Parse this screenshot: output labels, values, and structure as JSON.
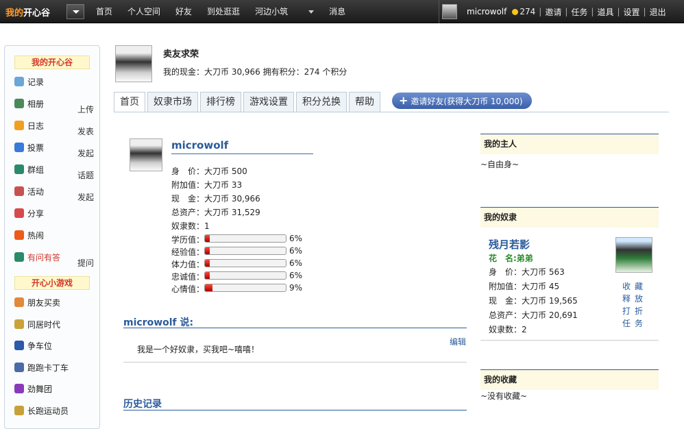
{
  "topbar": {
    "logo_a": "我的",
    "logo_b": "开心谷",
    "nav": [
      "首页",
      "个人空间",
      "好友",
      "到处逛逛",
      "河边小筑",
      "消息"
    ],
    "username": "microwolf",
    "coins": "274",
    "links": [
      "邀请",
      "任务",
      "道具",
      "设置",
      "退出"
    ]
  },
  "sidebar": {
    "head1": "我的开心谷",
    "items": [
      {
        "label": "记录",
        "action": "",
        "icon": "chat-icon",
        "color": "#6aa6d8"
      },
      {
        "label": "相册",
        "action": "上传",
        "icon": "photo-icon",
        "color": "#4a8a5a"
      },
      {
        "label": "日志",
        "action": "发表",
        "icon": "diary-icon",
        "color": "#f0a020"
      },
      {
        "label": "投票",
        "action": "发起",
        "icon": "chart-icon",
        "color": "#3a7ad8"
      },
      {
        "label": "群组",
        "action": "话题",
        "icon": "group-icon",
        "color": "#2a8a6a"
      },
      {
        "label": "活动",
        "action": "发起",
        "icon": "calendar-icon",
        "color": "#c85050"
      },
      {
        "label": "分享",
        "action": "",
        "icon": "heart-icon",
        "color": "#d84a4a"
      },
      {
        "label": "热闹",
        "action": "",
        "icon": "fire-icon",
        "color": "#ee5a1a"
      },
      {
        "label": "有问有答",
        "action": "提问",
        "icon": "qa-icon",
        "color": "#2a8a6a",
        "red": true
      }
    ],
    "head2": "开心小游戏",
    "games": [
      {
        "label": "朋友买卖",
        "icon": "people-icon",
        "color": "#e08a3a"
      },
      {
        "label": "同居时代",
        "icon": "house-icon",
        "color": "#caa23a"
      },
      {
        "label": "争车位",
        "icon": "parking-icon",
        "color": "#2a5aa8"
      },
      {
        "label": "跑跑卡丁车",
        "icon": "kart-icon",
        "color": "#4a6aa8"
      },
      {
        "label": "劲舞团",
        "icon": "dance-icon",
        "color": "#8a3ab8"
      },
      {
        "label": "长跑运动员",
        "icon": "runner-icon",
        "color": "#c8a03a"
      }
    ]
  },
  "header": {
    "title": "卖友求荣",
    "money_line": "我的现金：大刀币 30,966 拥有积分：274 个积分"
  },
  "tabs": [
    "首页",
    "奴隶市场",
    "排行榜",
    "游戏设置",
    "积分兑换",
    "帮助"
  ],
  "invite_label": "邀请好友(获得大刀币 10,000)",
  "profile": {
    "name": "microwolf",
    "stats": [
      "身　价：大刀币 500",
      "附加值：大刀币 33",
      "现　金：大刀币 30,966",
      "总资产：大刀币 31,529",
      "奴隶数：1"
    ],
    "bars": [
      {
        "label": "学历值：",
        "pct": "6%",
        "value": 0.06
      },
      {
        "label": "经验值：",
        "pct": "6%",
        "value": 0.06
      },
      {
        "label": "体力值：",
        "pct": "6%",
        "value": 0.06
      },
      {
        "label": "忠诚值：",
        "pct": "6%",
        "value": 0.06
      },
      {
        "label": "心情值：",
        "pct": "9%",
        "value": 0.09
      }
    ]
  },
  "says": {
    "title": "microwolf 说:",
    "edit": "编辑",
    "text": "我是一个好奴隶，买我吧~嘻嘻！"
  },
  "history_title": "历史记录",
  "master": {
    "title": "我的主人",
    "text": "~自由身~"
  },
  "slaves": {
    "title": "我的奴隶",
    "name": "残月若影",
    "nick": "花　名:弟弟",
    "stats": [
      "身　价：大刀币 563",
      "附加值：大刀币 45",
      "现　金：大刀币 19,565",
      "总资产：大刀币 20,691",
      "奴隶数：2"
    ],
    "actions": [
      "收藏",
      "释放",
      "打折",
      "任务"
    ]
  },
  "collection": {
    "title": "我的收藏",
    "text": "~没有收藏~"
  }
}
